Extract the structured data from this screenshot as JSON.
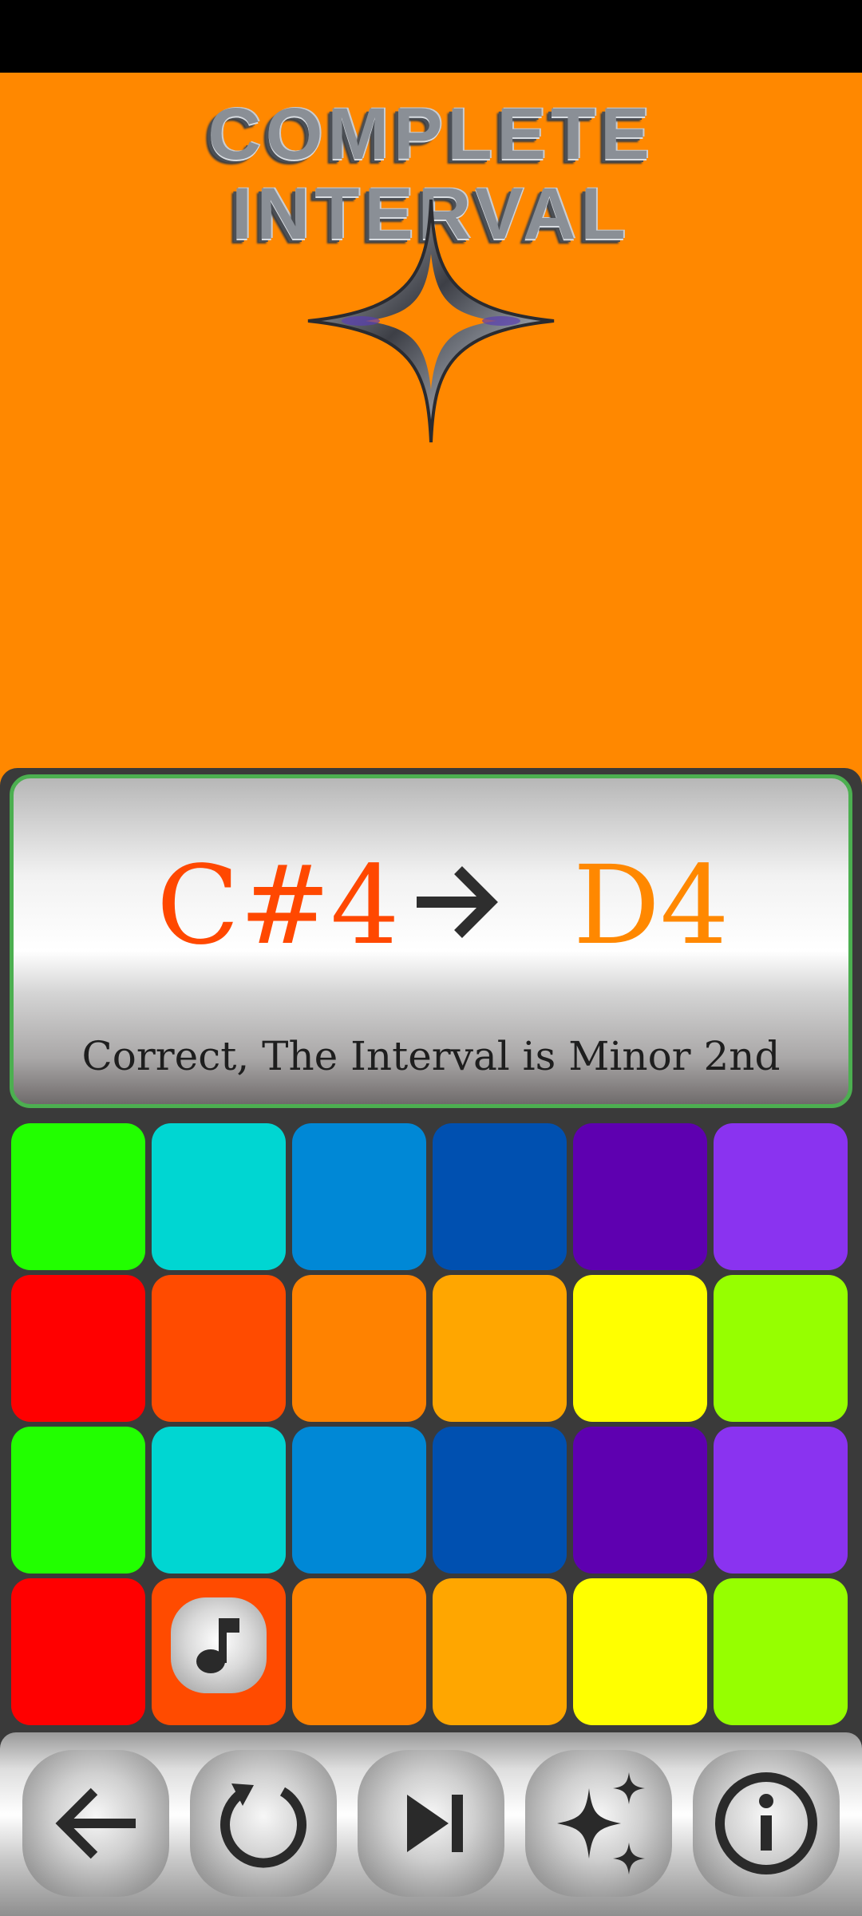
{
  "title": "COMPLETE INTERVAL",
  "interval": {
    "first_note": "C#4",
    "second_note": "D4",
    "feedback": "Correct, The Interval is Minor 2nd"
  },
  "colors": {
    "background": "#ff8800",
    "first_note": "#ff4800",
    "second_note": "#ff8800",
    "card_border": "#4caf50"
  },
  "pads": [
    {
      "color": "#22ff00"
    },
    {
      "color": "#00d6d2"
    },
    {
      "color": "#0088d6"
    },
    {
      "color": "#0050b0"
    },
    {
      "color": "#5e00b0"
    },
    {
      "color": "#8a33f0"
    },
    {
      "color": "#ff0000"
    },
    {
      "color": "#ff4b00"
    },
    {
      "color": "#ff8200"
    },
    {
      "color": "#ffa600"
    },
    {
      "color": "#ffff00"
    },
    {
      "color": "#96ff00"
    },
    {
      "color": "#22ff00"
    },
    {
      "color": "#00d6d2"
    },
    {
      "color": "#0088d6"
    },
    {
      "color": "#0050b0"
    },
    {
      "color": "#5e00b0"
    },
    {
      "color": "#8a33f0"
    },
    {
      "color": "#ff0000"
    },
    {
      "color": "#ff4b00",
      "icon": "music-note-icon"
    },
    {
      "color": "#ff8200"
    },
    {
      "color": "#ffa600"
    },
    {
      "color": "#ffff00"
    },
    {
      "color": "#96ff00"
    }
  ],
  "toolbar": [
    {
      "icon": "arrow-left-icon",
      "name": "back-button"
    },
    {
      "icon": "replay-icon",
      "name": "replay-button"
    },
    {
      "icon": "skip-next-icon",
      "name": "next-button"
    },
    {
      "icon": "sparkles-icon",
      "name": "hint-button"
    },
    {
      "icon": "info-icon",
      "name": "info-button"
    }
  ]
}
